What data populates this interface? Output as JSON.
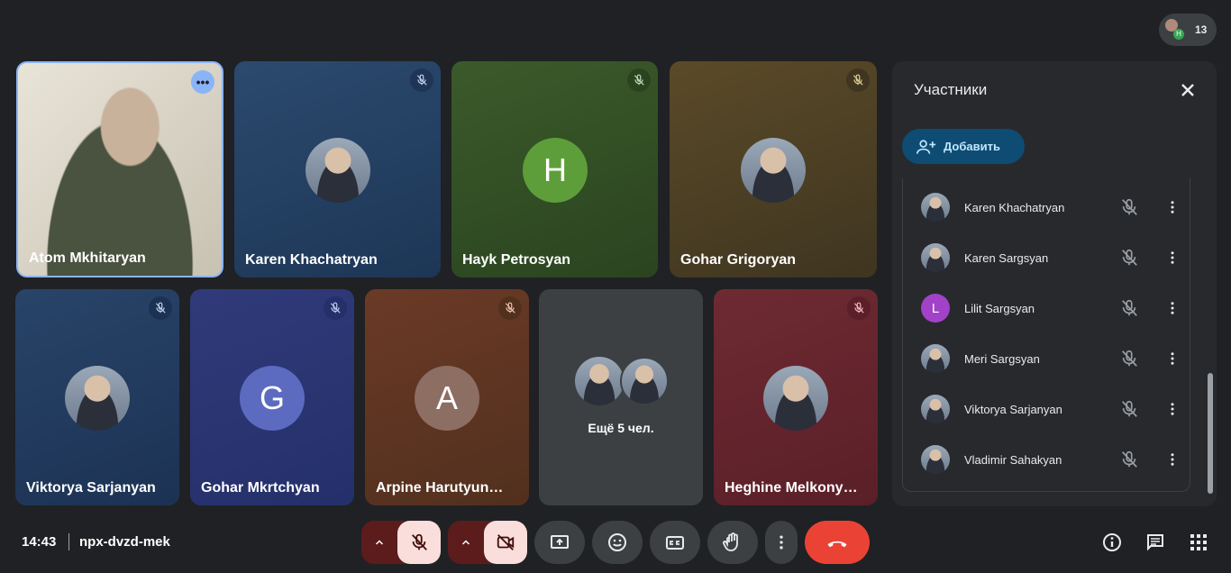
{
  "header": {
    "participant_count": "13",
    "mini_avatar_letter": "H"
  },
  "tiles": [
    {
      "name": "Atom Mkhitaryan"
    },
    {
      "name": "Karen Khachatryan"
    },
    {
      "name": "Hayk Petrosyan",
      "initial": "H",
      "color": "#5e9e3a"
    },
    {
      "name": "Gohar Grigoryan"
    },
    {
      "name": "Viktorya Sarjanyan"
    },
    {
      "name": "Gohar Mkrtchyan",
      "initial": "G",
      "color": "#5c6bc0"
    },
    {
      "name": "Arpine Harutyunyan",
      "initial": "A",
      "color": "#8d6e63"
    },
    {
      "more_label": "Ещё 5 чел."
    },
    {
      "name": "Heghine Melkonyan"
    }
  ],
  "panel": {
    "title": "Участники",
    "add_label": "Добавить",
    "participants": [
      {
        "name": "Karen Khachatryan"
      },
      {
        "name": "Karen Sargsyan"
      },
      {
        "name": "Lilit Sargsyan",
        "initial": "L",
        "color": "#a142c8"
      },
      {
        "name": "Meri Sargsyan"
      },
      {
        "name": "Viktorya Sarjanyan"
      },
      {
        "name": "Vladimir Sahakyan"
      }
    ]
  },
  "footer": {
    "time": "14:43",
    "meeting_code": "npx-dvzd-mek"
  },
  "colors": {
    "accent": "#8ab4f8",
    "leave": "#ea4335",
    "muted_bg": "#f9dedc"
  }
}
